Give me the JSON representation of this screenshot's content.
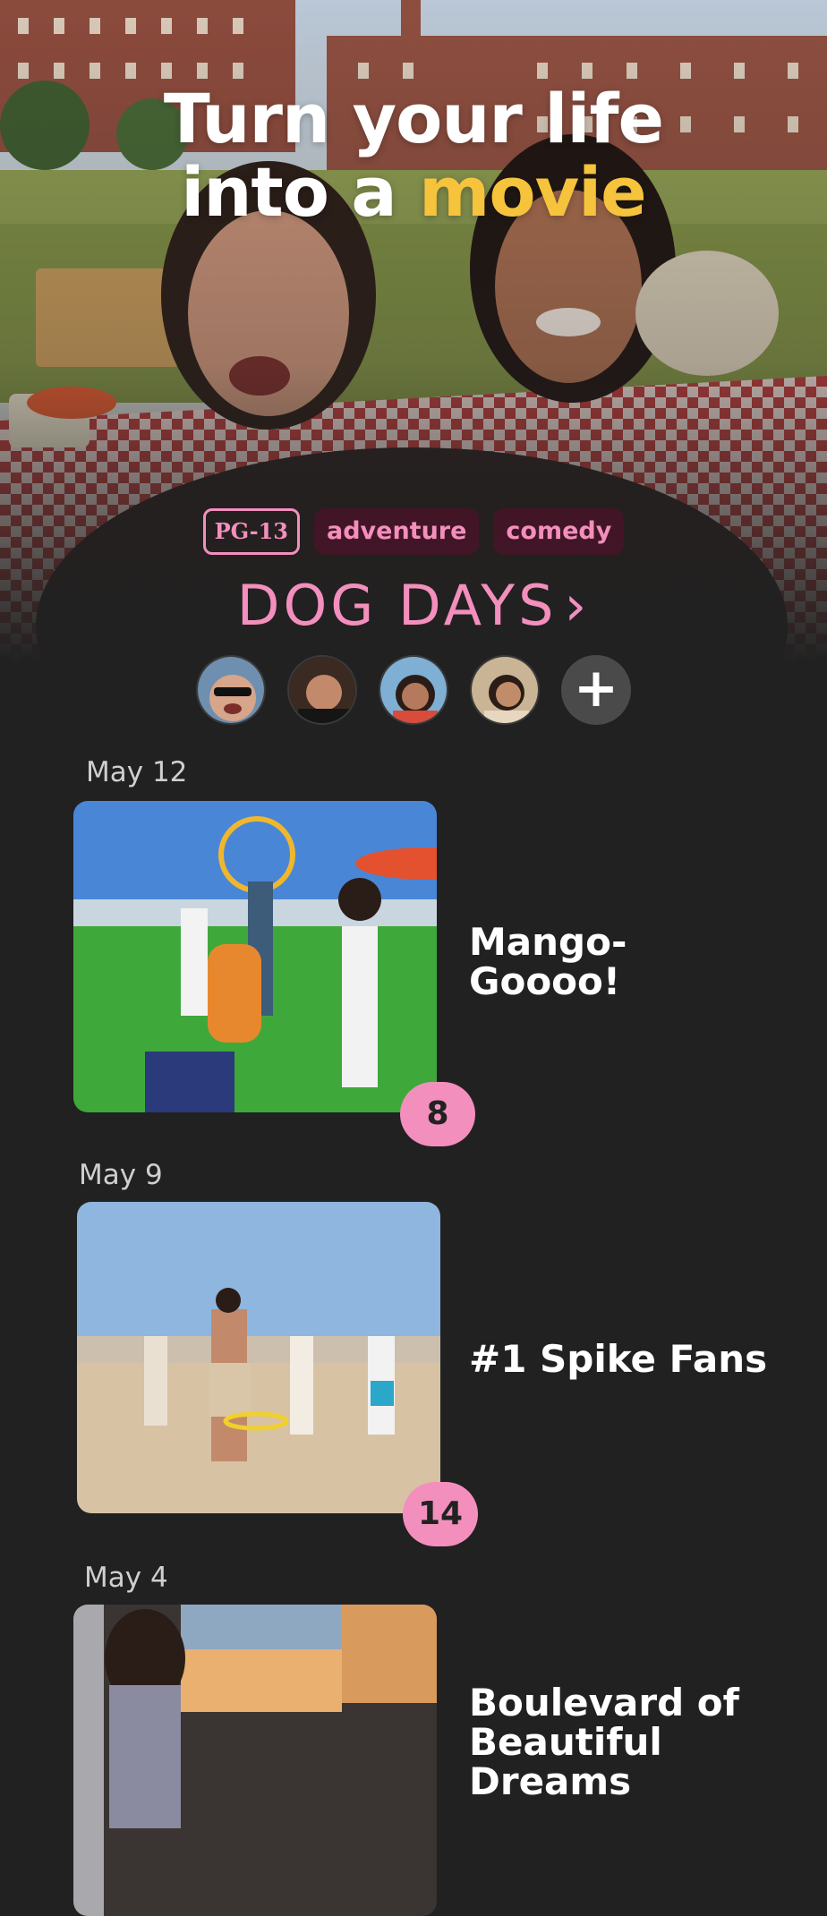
{
  "hero": {
    "headline_line1": "Turn your life",
    "headline_line2_plain": "into a ",
    "headline_line2_accent": "movie",
    "tags": [
      "PG-13",
      "adventure",
      "comedy"
    ],
    "movie_title": "DOG DAYS",
    "chevron": "›"
  },
  "cast": {
    "add_label": "+"
  },
  "feed": [
    {
      "date": "May 12",
      "title": "Mango-Goooo!",
      "count": "8"
    },
    {
      "date": "May 9",
      "title": "#1 Spike Fans",
      "count": "14"
    },
    {
      "date": "May 4",
      "title": "Boulevard of Beautiful Dreams",
      "count": ""
    }
  ],
  "colors": {
    "background": "#212121",
    "accent_pink": "#f38fbd",
    "accent_yellow": "#f6c33c"
  }
}
